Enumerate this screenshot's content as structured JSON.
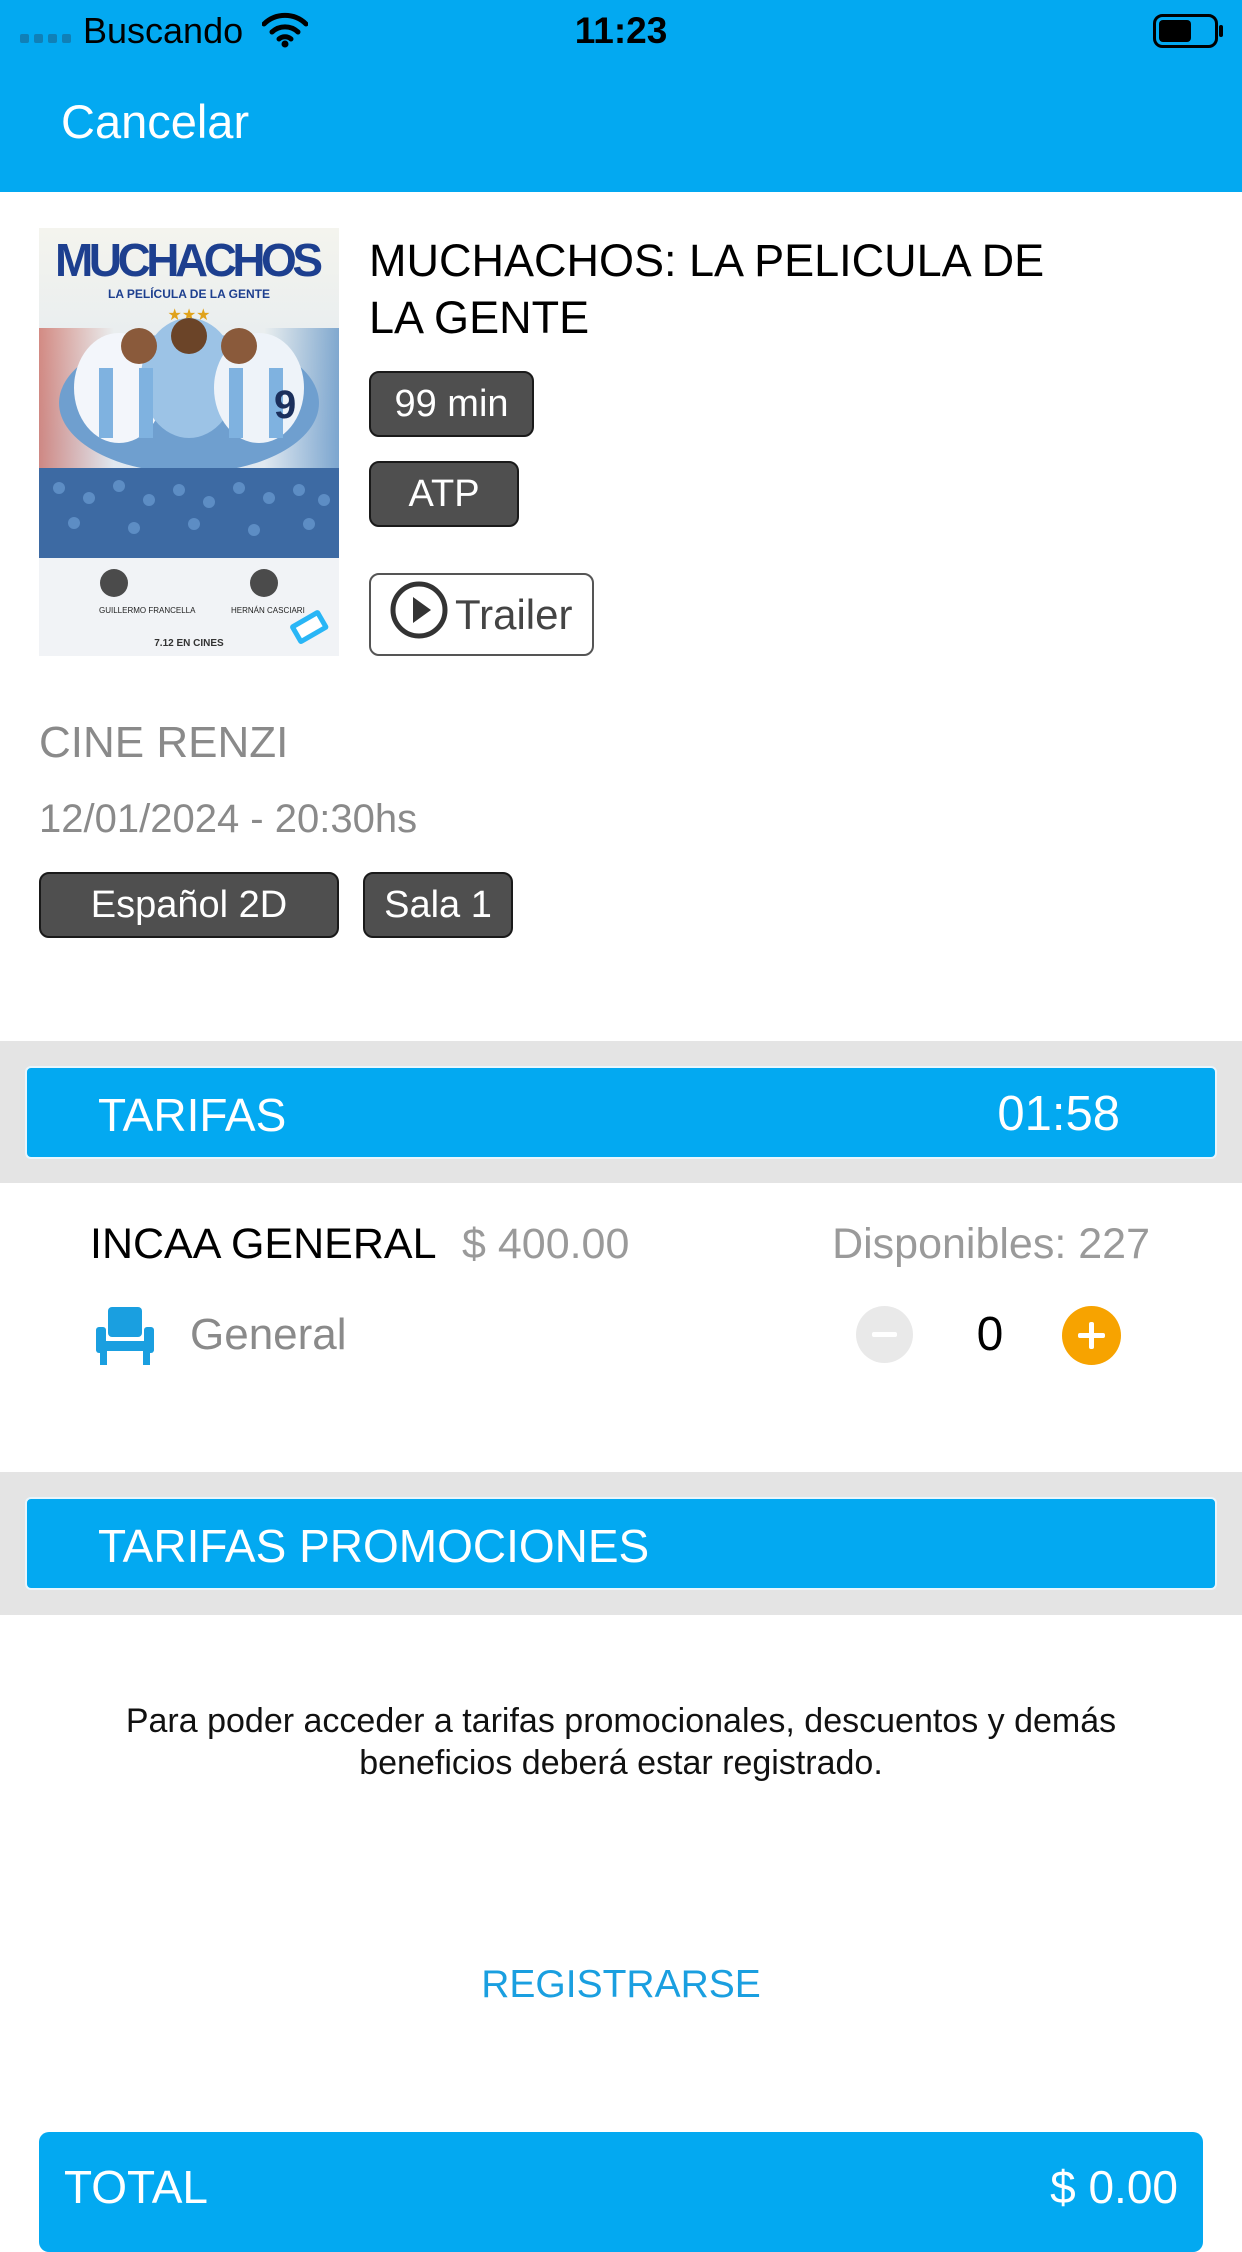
{
  "status_bar": {
    "carrier": "Buscando",
    "time": "11:23"
  },
  "nav": {
    "cancel_label": "Cancelar"
  },
  "movie": {
    "title": "MUCHACHOS: LA PELICULA DE LA GENTE",
    "duration": "99 min",
    "rating": "ATP",
    "trailer_label": "Trailer",
    "poster": {
      "title": "MUCHACHOS",
      "subtitle": "LA PELÍCULA DE LA GENTE",
      "stars": "★★★",
      "credit_left": "GUILLERMO FRANCELLA",
      "credit_right": "HERNÁN CASCIARI",
      "release": "7.12 EN CINES"
    }
  },
  "showing": {
    "cinema": "CINE RENZI",
    "datetime": "12/01/2024 - 20:30hs",
    "format": "Español 2D",
    "room": "Sala 1"
  },
  "tariffs": {
    "title": "TARIFAS",
    "timer": "01:58",
    "items": [
      {
        "name": "INCAA GENERAL",
        "price": "$ 400.00",
        "available": "Disponibles: 227",
        "seat_type": "General",
        "quantity": "0"
      }
    ]
  },
  "promotions": {
    "title": "TARIFAS PROMOCIONES",
    "message": "Para poder acceder a tarifas promocionales, descuentos y demás beneficios deberá estar registrado.",
    "register_label": "REGISTRARSE"
  },
  "total": {
    "label": "TOTAL",
    "value": "$ 0.00"
  },
  "colors": {
    "primary": "#03a9f1",
    "accent": "#f7a300",
    "chip": "#4f4f4f",
    "band": "#e4e4e4"
  }
}
